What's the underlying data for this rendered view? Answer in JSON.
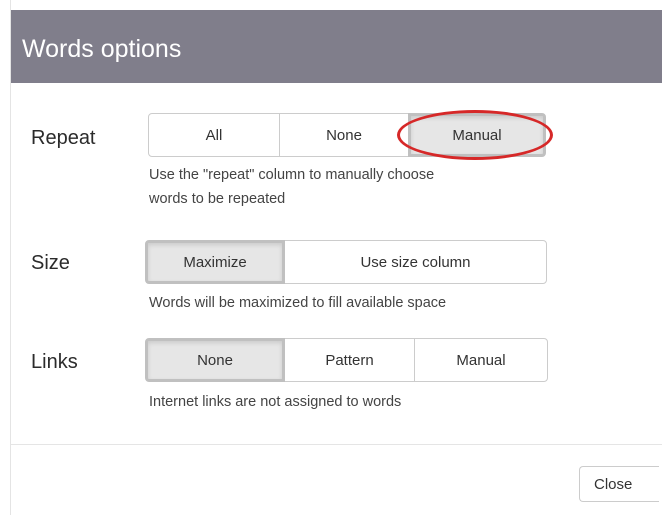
{
  "dialog": {
    "title": "Words options"
  },
  "repeat": {
    "label": "Repeat",
    "options": [
      "All",
      "None",
      "Manual"
    ],
    "selected": "Manual",
    "help": "Use the \"repeat\" column to manually choose",
    "help_line2": "words to be repeated"
  },
  "size": {
    "label": "Size",
    "options": [
      "Maximize",
      "Use size column"
    ],
    "selected": "Maximize",
    "help": "Words will be maximized to fill available space"
  },
  "links": {
    "label": "Links",
    "options": [
      "None",
      "Pattern",
      "Manual"
    ],
    "selected": "None",
    "help": "Internet links are not assigned to words"
  },
  "footer": {
    "close_label": "Close"
  },
  "colors": {
    "header_bg": "#807e8b",
    "active_bg": "#e6e6e6",
    "annotation": "#d62828"
  }
}
